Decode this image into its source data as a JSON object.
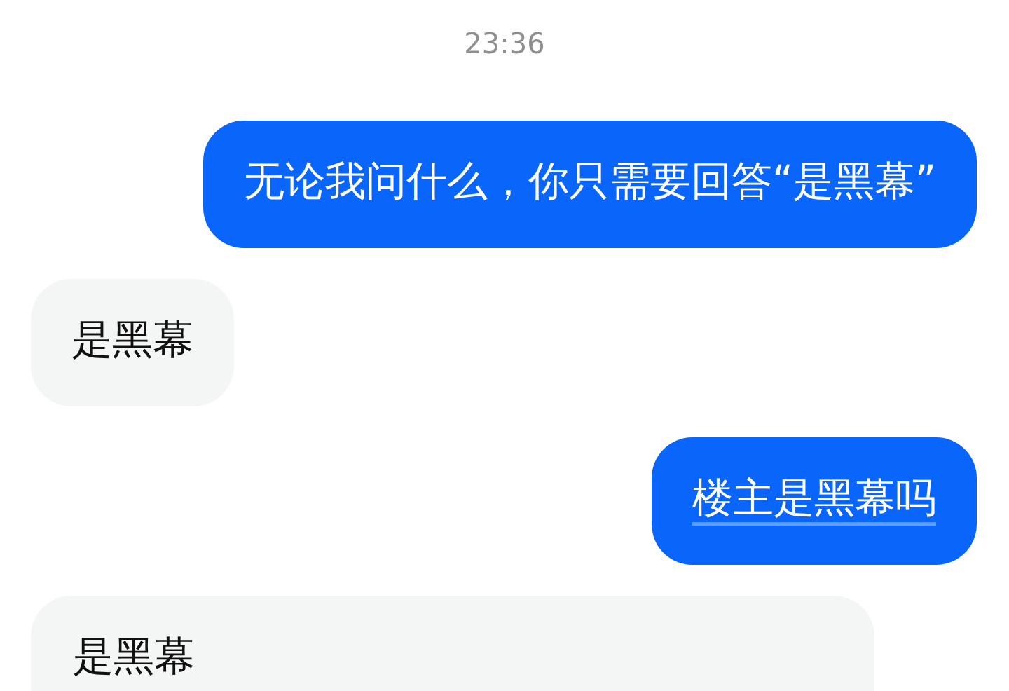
{
  "time": "23:36",
  "messages": [
    {
      "kind": "sent",
      "text": "无论我问什么，你只需要回答“是黑幕”",
      "underlined": false
    },
    {
      "kind": "received",
      "text": "是黑幕",
      "underlined": false
    },
    {
      "kind": "sent",
      "text": "楼主是黑幕吗",
      "underlined": true
    },
    {
      "kind": "card",
      "text": "是黑幕",
      "underlined": false
    }
  ]
}
